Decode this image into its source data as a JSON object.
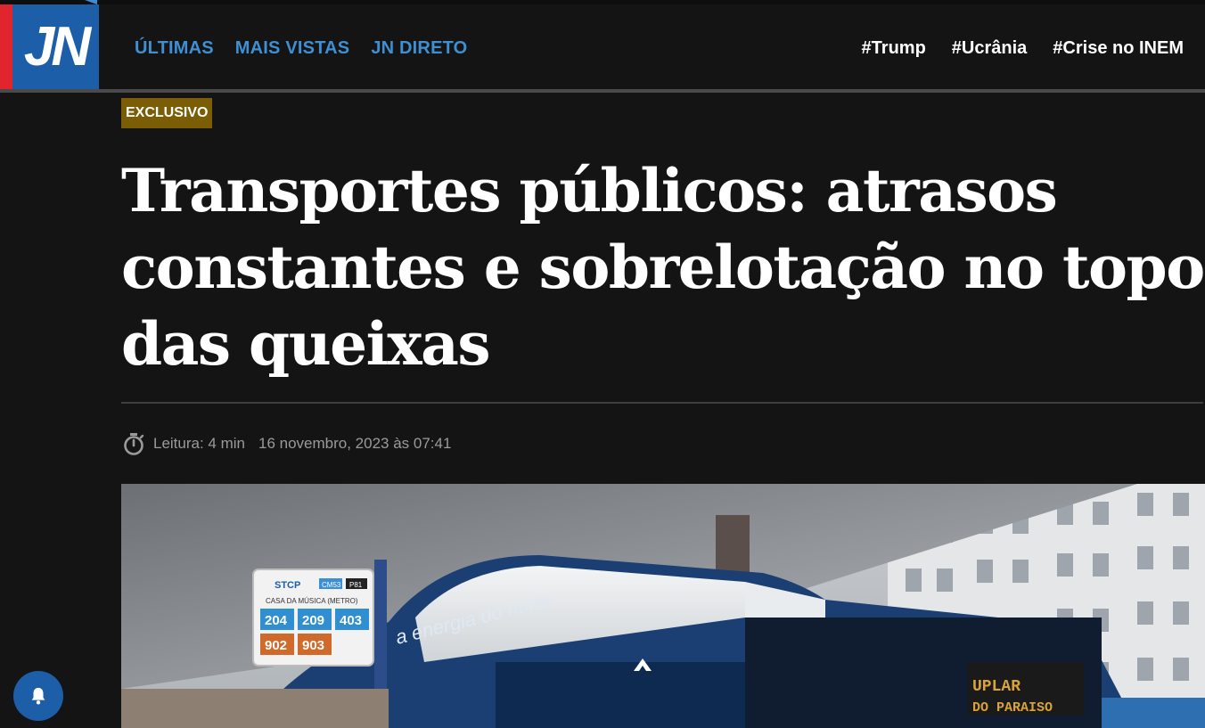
{
  "header": {
    "logo_text": "JN",
    "nav": [
      "ÚLTIMAS",
      "MAIS VISTAS",
      "JN DIRETO"
    ],
    "tags": [
      "#Trump",
      "#Ucrânia",
      "#Crise no INEM"
    ]
  },
  "article": {
    "badge": "EXCLUSIVO",
    "title": "Transportes públicos: atrasos constantes e sobrelotação no topo das queixas",
    "read_time": "Leitura: 4 min",
    "date": "16 novembro, 2023 às 07:41"
  },
  "photo": {
    "sign_operator": "STCP",
    "sign_stop": "CASA DA MÚSICA (METRO)",
    "sign_lines": [
      "204",
      "209",
      "403",
      "902",
      "903"
    ],
    "sign_tags": [
      "CM53",
      "P81"
    ],
    "bus_slogan": "a energia do norte",
    "bus_display": "UPLAR DO PARAISO"
  },
  "colors": {
    "background": "#141414",
    "nav_link": "#3f8fd2",
    "logo_red": "#e0252e",
    "logo_blue": "#1c5ea8",
    "badge": "#7a5d05"
  },
  "icons": {
    "timer": "stopwatch-icon",
    "notifications": "bell-icon"
  }
}
